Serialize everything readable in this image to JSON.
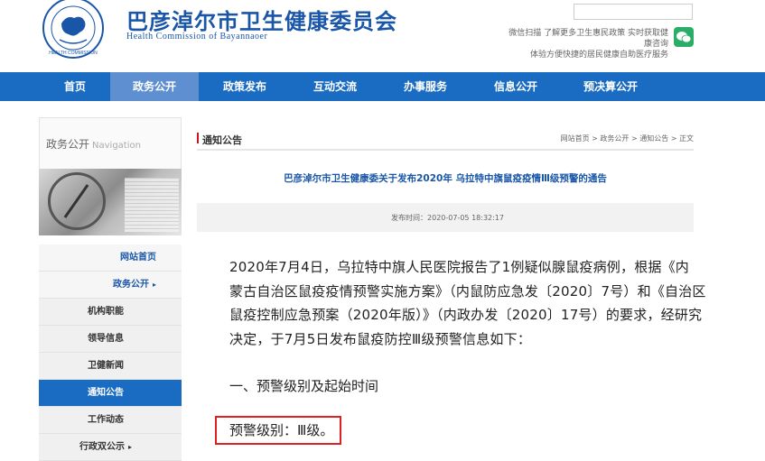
{
  "header": {
    "title": "巴彦淖尔市卫生健康委员会",
    "subtitle": "Health Commission of Bayannaoer",
    "emblem_text": "HEALTH COMMISSION",
    "wechat_line1": "微信扫描 了解更多卫生惠民政策 实时获取健康咨询",
    "wechat_line2": "体验方便快捷的居民健康自助医疗服务",
    "colors": {
      "brand": "#1a56a8",
      "nav": "#1a6bc2",
      "nav_active": "#5e8fd1",
      "wechat": "#2aae67"
    }
  },
  "nav": {
    "items": [
      "首页",
      "政务公开",
      "政策发布",
      "互动交流",
      "办事服务",
      "信息公开",
      "预决算公开"
    ],
    "active": "政务公开"
  },
  "sidebar": {
    "title": "政务公开",
    "title_en": "Navigation",
    "items": [
      {
        "label": "网站首页"
      },
      {
        "label": "政务公开",
        "arrow": "▸"
      },
      {
        "label": "机构职能"
      },
      {
        "label": "领导信息"
      },
      {
        "label": "卫健新闻"
      },
      {
        "label": "通知公告"
      },
      {
        "label": "工作动态"
      },
      {
        "label": "行政双公示",
        "arrow": "▸"
      }
    ],
    "active": "通知公告"
  },
  "main": {
    "section_title": "通知公告",
    "breadcrumb": "网站首页 > 政务公开 > 通知公告 > 正文",
    "article_title": "巴彦淖尔市卫生健康委关于发布2020年 乌拉特中旗鼠疫疫情Ⅲ级预警的通告",
    "publish_time": "发布时间：2020-07-05 18:32:17",
    "paragraph_lines": [
      "2020年7月4日，乌拉特中旗人民医院报告了1例疑似腺鼠疫病例，根据《内",
      "蒙古自治区鼠疫疫情预警实施方案》（内鼠防应急发〔2020〕7号）和《自治区",
      "鼠疫控制应急预案（2020年版）》（内政办发〔2020〕17号）的要求，经研究",
      "决定，于7月5日发布鼠疫防控Ⅲ级预警信息如下："
    ],
    "section_heading": "一、预警级别及起始时间",
    "warning_level": "预警级别：Ⅲ级。"
  }
}
